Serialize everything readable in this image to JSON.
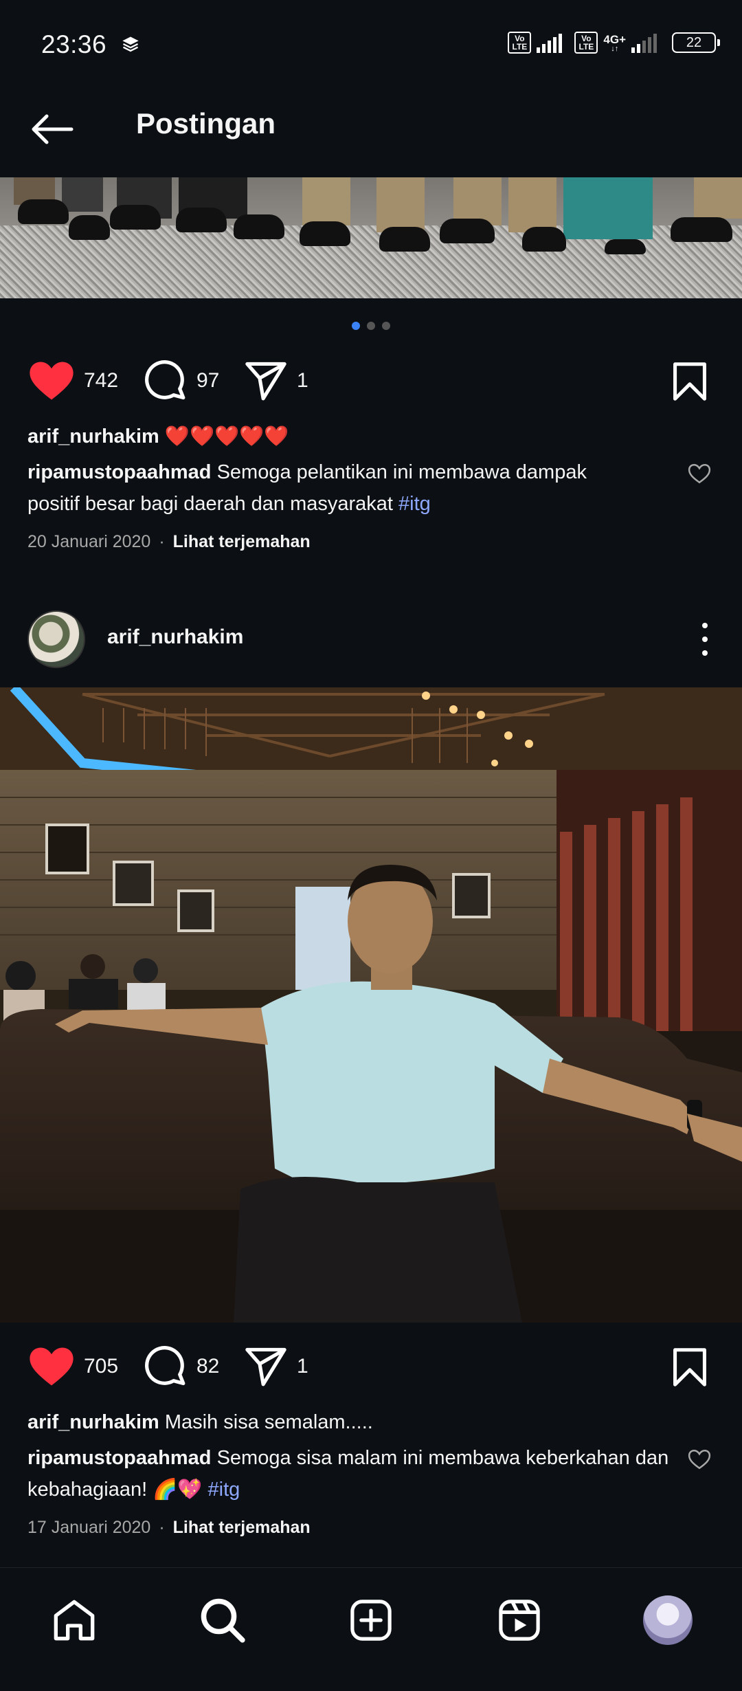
{
  "status_bar": {
    "time": "23:36",
    "volte_label": "Vo\nLTE",
    "network_type": "4G+",
    "battery": "22"
  },
  "header": {
    "title": "Postingan",
    "back_icon": "arrow-left-icon"
  },
  "carousel": {
    "count": 3,
    "active_index": 0
  },
  "post1": {
    "likes": "742",
    "comments": "97",
    "shares": "1",
    "caption_user": "arif_nurhakim",
    "caption_text": "❤️❤️❤️❤️❤️",
    "comment_user": "ripamustopaahmad",
    "comment_text": "Semoga pelantikan ini membawa dampak positif besar bagi daerah dan masyarakat",
    "comment_hashtag": "#itg",
    "date": "20 Januari 2020",
    "separator": "·",
    "translate_label": "Lihat terjemahan"
  },
  "post2": {
    "username": "arif_nurhakim",
    "likes": "705",
    "comments": "82",
    "shares": "1",
    "caption_user": "arif_nurhakim",
    "caption_text": "Masih sisa semalam.....",
    "comment_user": "ripamustopaahmad",
    "comment_text": "Semoga sisa malam ini membawa keberkahan dan kebahagiaan! 🌈💖",
    "comment_hashtag": "#itg",
    "date": "17 Januari 2020",
    "separator": "·",
    "translate_label": "Lihat terjemahan"
  },
  "colors": {
    "background": "#0c1014",
    "like_red": "#ff3040",
    "hashtag_blue": "#8ea8ff",
    "carousel_active": "#3b82f6"
  },
  "bottom_nav": {
    "items": [
      "home-icon",
      "search-icon",
      "create-icon",
      "reels-icon",
      "profile-avatar"
    ]
  }
}
